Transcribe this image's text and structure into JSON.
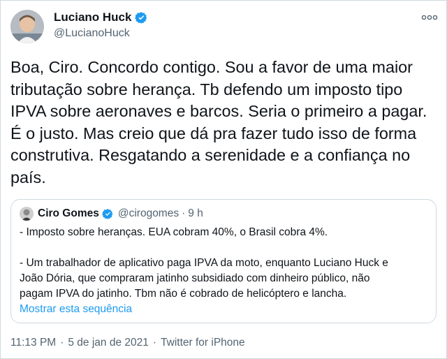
{
  "author": {
    "name": "Luciano Huck",
    "handle": "@LucianoHuck"
  },
  "tweet": {
    "text": "Boa, Ciro. Concordo contigo. Sou a favor de uma maior\ntributação sobre herança. Tb defendo um imposto tipo\nIPVA sobre aeronaves e barcos. Seria o primeiro a pagar.\nÉ o justo. Mas creio que dá pra fazer tudo isso de forma\nconstrutiva. Resgatando a serenidade e a confiança no\npaís."
  },
  "quoted": {
    "name": "Ciro Gomes",
    "handle": "@cirogomes",
    "separator": "·",
    "time": "9 h",
    "line1": "- Imposto sobre heranças. EUA cobram 40%, o Brasil cobra 4%.",
    "line2": "- Um trabalhador de aplicativo paga IPVA da moto, enquanto Luciano Huck e",
    "line3": "João Dória, que compraram jatinho subsidiado com dinheiro público, não",
    "line4": "pagam IPVA do jatinho. Tbm não é cobrado de helicóptero e lancha.",
    "show_thread": "Mostrar esta sequência"
  },
  "footer": {
    "time": "11:13 PM",
    "separator": "·",
    "date": "5 de jan de 2021",
    "source": "Twitter for iPhone"
  },
  "icons": {
    "verified": "verified-badge-icon",
    "more": "more-options-icon"
  },
  "colors": {
    "link": "#1d9bf0",
    "secondary_text": "#536471",
    "verified_badge": "#1d9bf0",
    "border": "#cfd9de"
  }
}
